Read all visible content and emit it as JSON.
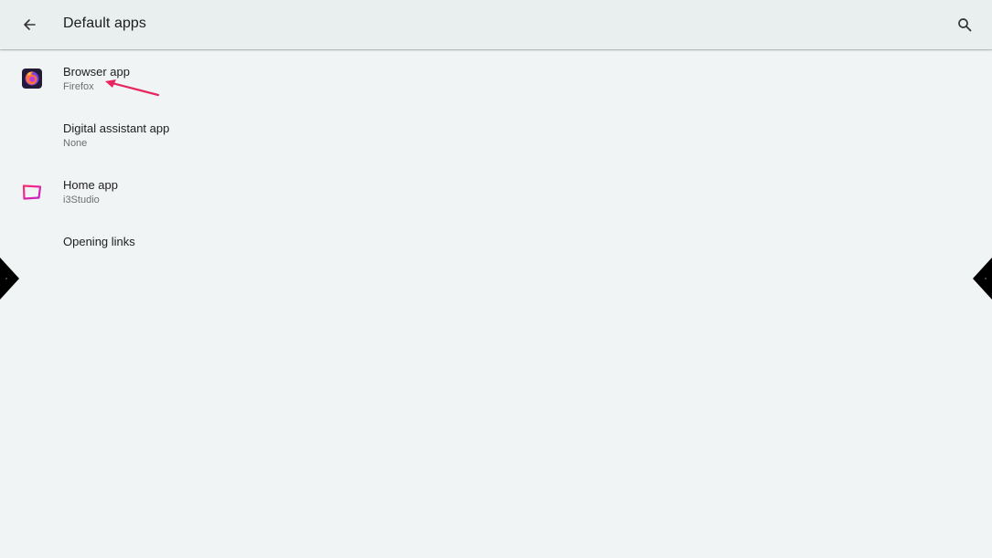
{
  "header": {
    "title": "Default apps",
    "back_icon": "arrow-back-icon",
    "search_icon": "search-icon"
  },
  "items": [
    {
      "title": "Browser app",
      "summary": "Firefox",
      "icon": "firefox-icon"
    },
    {
      "title": "Digital assistant app",
      "summary": "None",
      "icon": ""
    },
    {
      "title": "Home app",
      "summary": "i3Studio",
      "icon": "i3studio-icon"
    },
    {
      "title": "Opening links",
      "summary": "",
      "icon": ""
    }
  ],
  "annotation": {
    "color": "#e8265e",
    "icon": "arrow-annotation"
  },
  "colors": {
    "background": "#f0f4f5",
    "app_bar": "#e9eeef",
    "home_icon_gradient": [
      "#ff2d6f",
      "#c51dd0"
    ]
  }
}
